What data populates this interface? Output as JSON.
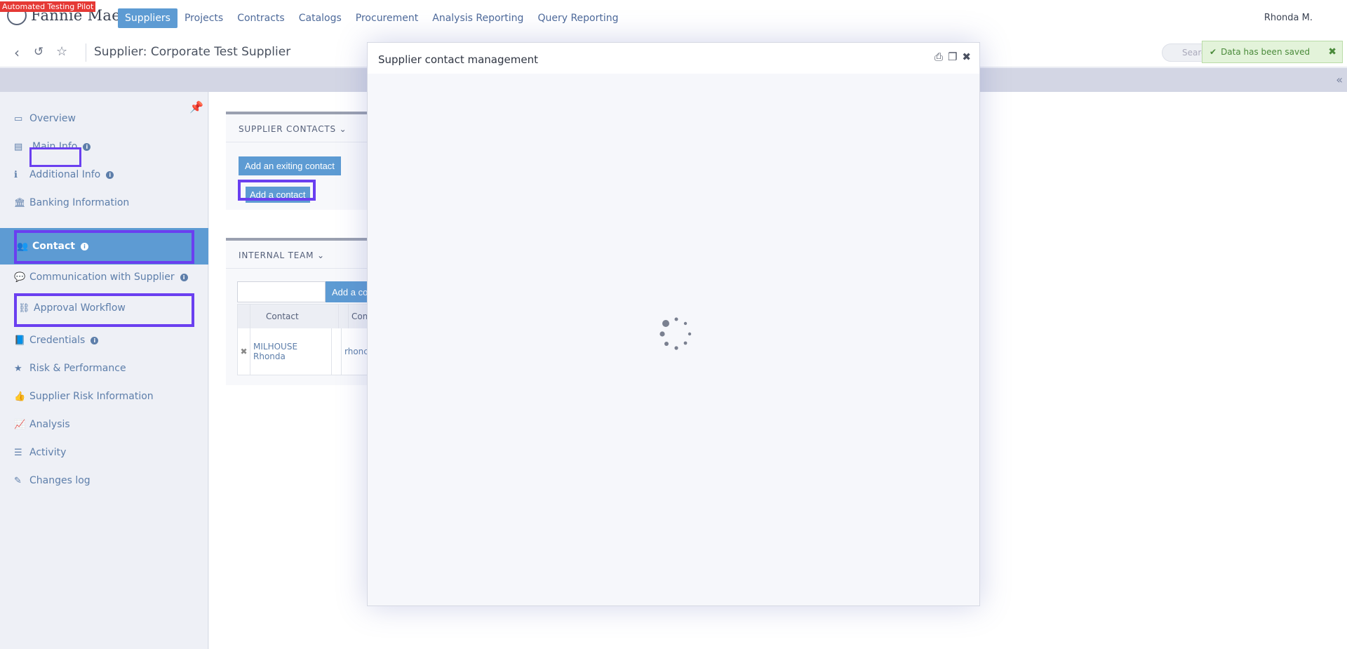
{
  "badge": "Automated Testing Pilot",
  "logo": {
    "text": "Fannie Mae",
    "tm": "™"
  },
  "nav": [
    "Suppliers",
    "Projects",
    "Contracts",
    "Catalogs",
    "Procurement",
    "Analysis Reporting",
    "Query Reporting"
  ],
  "user": "Rhonda M.",
  "page_title": "Supplier: Corporate Test Supplier",
  "search_placeholder": "Search",
  "toast": "Data has been saved",
  "sidebar": [
    {
      "label": "Overview",
      "icon": "monitor-icon"
    },
    {
      "label": "Main Info",
      "icon": "id-card-icon",
      "info": true
    },
    {
      "label": "Additional Info",
      "icon": "info-icon",
      "info": true
    },
    {
      "label": "Banking Information",
      "icon": "bank-icon"
    },
    {
      "label": "Contact",
      "icon": "users-icon",
      "info": true,
      "active": true
    },
    {
      "label": "Communication with Supplier",
      "icon": "comments-icon",
      "info": true
    },
    {
      "label": "Approval Workflow",
      "icon": "workflow-icon"
    },
    {
      "label": "Credentials",
      "icon": "book-icon",
      "info": true
    },
    {
      "label": "Risk & Performance",
      "icon": "star-icon"
    },
    {
      "label": "Supplier Risk Information",
      "icon": "thumbs-up-icon"
    },
    {
      "label": "Analysis",
      "icon": "chart-icon"
    },
    {
      "label": "Activity",
      "icon": "list-icon"
    },
    {
      "label": "Changes log",
      "icon": "edit-icon"
    }
  ],
  "supplier_contacts": {
    "heading": "SUPPLIER CONTACTS",
    "add_existing": "Add an exiting contact",
    "add_contact": "Add a contact"
  },
  "internal_team": {
    "heading": "INTERNAL TEAM",
    "add_button": "Add a co",
    "columns": [
      "Contact",
      "Comm"
    ],
    "row": {
      "contact": "MILHOUSE Rhonda",
      "comm": "rhonc"
    }
  },
  "modal": {
    "title": "Supplier contact management"
  }
}
